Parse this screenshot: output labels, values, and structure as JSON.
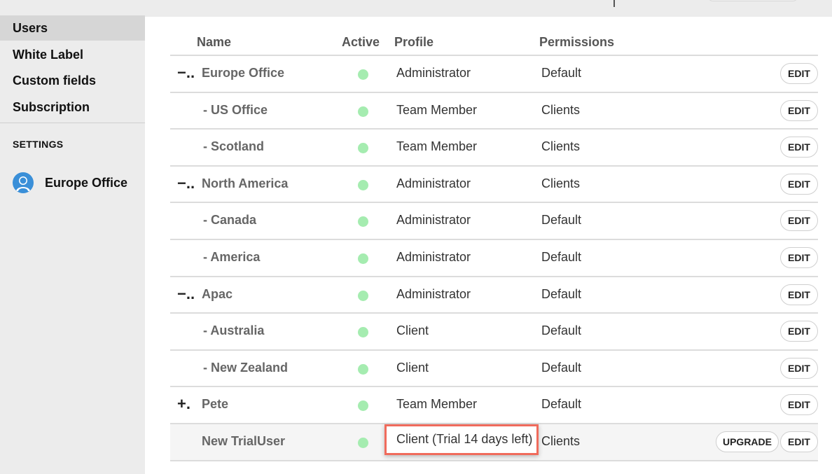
{
  "sidebar": {
    "items": [
      {
        "label": "Users",
        "active": true
      },
      {
        "label": "White Label",
        "active": false
      },
      {
        "label": "Custom fields",
        "active": false
      },
      {
        "label": "Subscription",
        "active": false
      }
    ],
    "settings_label": "SETTINGS",
    "account_name": "Europe Office"
  },
  "table": {
    "headers": {
      "name": "Name",
      "active": "Active",
      "profile": "Profile",
      "permissions": "Permissions"
    },
    "rows": [
      {
        "toggle": "−..",
        "name": "Europe Office",
        "profile": "Administrator",
        "permissions": "Default",
        "edit": "EDIT"
      },
      {
        "toggle": "",
        "name": "- US Office",
        "profile": "Team Member",
        "permissions": "Clients",
        "edit": "EDIT"
      },
      {
        "toggle": "",
        "name": "- Scotland",
        "profile": "Team Member",
        "permissions": "Clients",
        "edit": "EDIT"
      },
      {
        "toggle": "−..",
        "name": "North America",
        "profile": "Administrator",
        "permissions": "Clients",
        "edit": "EDIT"
      },
      {
        "toggle": "",
        "name": "- Canada",
        "profile": "Administrator",
        "permissions": "Default",
        "edit": "EDIT"
      },
      {
        "toggle": "",
        "name": "- America",
        "profile": "Administrator",
        "permissions": "Default",
        "edit": "EDIT"
      },
      {
        "toggle": "−..",
        "name": "Apac",
        "profile": "Administrator",
        "permissions": "Default",
        "edit": "EDIT"
      },
      {
        "toggle": "",
        "name": "- Australia",
        "profile": "Client",
        "permissions": "Default",
        "edit": "EDIT"
      },
      {
        "toggle": "",
        "name": "- New Zealand",
        "profile": "Client",
        "permissions": "Default",
        "edit": "EDIT"
      },
      {
        "toggle": "+.",
        "name": "Pete",
        "profile": "Team Member",
        "permissions": "Default",
        "edit": "EDIT"
      },
      {
        "toggle": "",
        "name": "New TrialUser",
        "profile": "Client (Trial 14 days left)",
        "permissions": "Clients",
        "upgrade": "UPGRADE",
        "edit": "EDIT"
      }
    ]
  },
  "icons": {
    "avatar": "user-avatar-icon",
    "active_status": "green-status-dot"
  },
  "colors": {
    "active_dot": "#a5ecb0",
    "highlight_border": "#f06b5c",
    "sidebar_bg": "#ececec",
    "active_nav_bg": "#d6d6d6",
    "avatar_bg": "#3a8fd8"
  }
}
